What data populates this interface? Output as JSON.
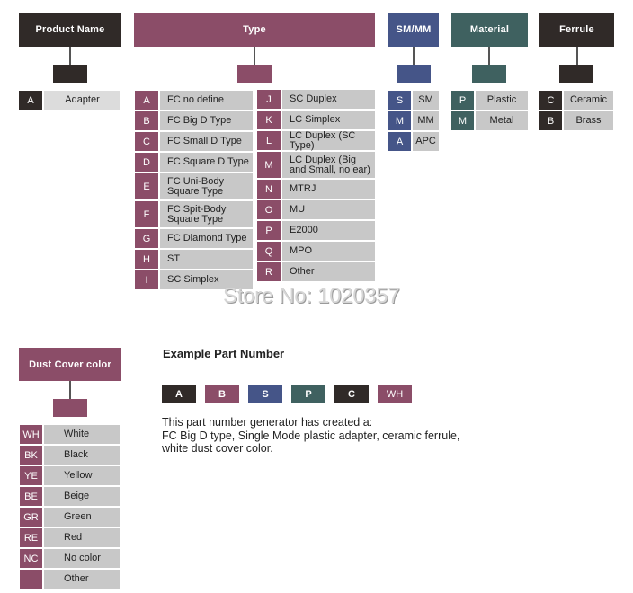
{
  "colors": {
    "dark": "#302a28",
    "mauve": "#8b4d68",
    "blue": "#455588",
    "teal": "#3f6160",
    "cell_gray": "#c8c8c8"
  },
  "product_name": {
    "header": "Product Name",
    "rows": [
      {
        "code": "A",
        "label": "Adapter"
      }
    ]
  },
  "type": {
    "header": "Type",
    "left_rows": [
      {
        "code": "A",
        "label": "FC no define"
      },
      {
        "code": "B",
        "label": "FC Big D Type"
      },
      {
        "code": "C",
        "label": "FC Small D Type"
      },
      {
        "code": "D",
        "label": "FC Square D Type"
      },
      {
        "code": "E",
        "label": "FC Uni-Body Square Type"
      },
      {
        "code": "F",
        "label": "FC Spit-Body Square Type"
      },
      {
        "code": "G",
        "label": "FC Diamond Type"
      },
      {
        "code": "H",
        "label": "ST"
      },
      {
        "code": "I",
        "label": "SC Simplex"
      }
    ],
    "right_rows": [
      {
        "code": "J",
        "label": "SC Duplex"
      },
      {
        "code": "K",
        "label": "LC Simplex"
      },
      {
        "code": "L",
        "label": "LC Duplex (SC Type)"
      },
      {
        "code": "M",
        "label": "LC Duplex (Big and Small, no ear)"
      },
      {
        "code": "N",
        "label": "MTRJ"
      },
      {
        "code": "O",
        "label": "MU"
      },
      {
        "code": "P",
        "label": "E2000"
      },
      {
        "code": "Q",
        "label": "MPO"
      },
      {
        "code": "R",
        "label": "Other"
      }
    ]
  },
  "smmm": {
    "header": "SM/MM",
    "rows": [
      {
        "code": "S",
        "label": "SM"
      },
      {
        "code": "M",
        "label": "MM"
      },
      {
        "code": "A",
        "label": "APC"
      }
    ]
  },
  "material": {
    "header": "Material",
    "rows": [
      {
        "code": "P",
        "label": "Plastic"
      },
      {
        "code": "M",
        "label": "Metal"
      }
    ]
  },
  "ferrule": {
    "header": "Ferrule",
    "rows": [
      {
        "code": "C",
        "label": "Ceramic"
      },
      {
        "code": "B",
        "label": "Brass"
      }
    ]
  },
  "dust_cover": {
    "header": "Dust Cover color",
    "rows": [
      {
        "code": "WH",
        "label": "White"
      },
      {
        "code": "BK",
        "label": "Black"
      },
      {
        "code": "YE",
        "label": "Yellow"
      },
      {
        "code": "BE",
        "label": "Beige"
      },
      {
        "code": "GR",
        "label": "Green"
      },
      {
        "code": "RE",
        "label": "Red"
      },
      {
        "code": "NC",
        "label": "No color"
      },
      {
        "code": "",
        "label": "Other"
      }
    ]
  },
  "watermark": "Store No: 1020357",
  "example": {
    "title": "Example Part Number",
    "chips": [
      "A",
      "B",
      "S",
      "P",
      "C",
      "WH"
    ],
    "description_lines": [
      "This part number generator has created a:",
      "FC Big D type, Single Mode plastic adapter, ceramic ferrule,",
      "white dust cover color."
    ]
  }
}
